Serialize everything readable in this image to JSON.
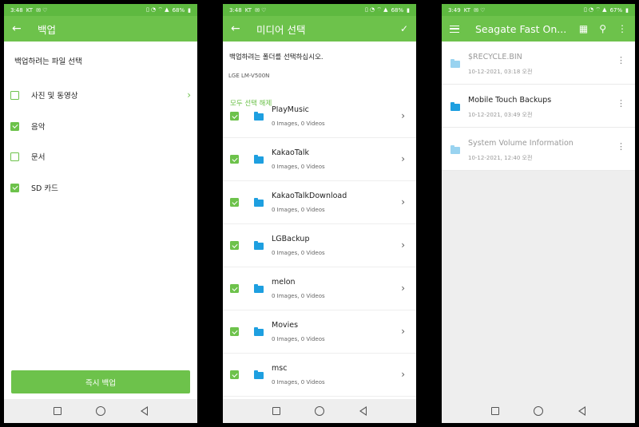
{
  "panel1": {
    "status": {
      "time": "3:48",
      "carrier": "KT",
      "battery": "68%"
    },
    "appbar": {
      "title": "백업"
    },
    "heading": "백업하려는 파일 선택",
    "options": [
      {
        "label": "사진 및 동영상",
        "checked": false,
        "has_chevron": true
      },
      {
        "label": "음악",
        "checked": true,
        "has_chevron": false
      },
      {
        "label": "문서",
        "checked": false,
        "has_chevron": false
      },
      {
        "label": "SD 카드",
        "checked": true,
        "has_chevron": false
      }
    ],
    "backup_button": "즉시 백업"
  },
  "panel2": {
    "status": {
      "time": "3:48",
      "carrier": "KT",
      "battery": "68%"
    },
    "appbar": {
      "title": "미디어 선택"
    },
    "instruction": "백업하려는 폴더를 선택하십시오.",
    "device": "LGE LM-V500N",
    "select_all": "모두 선택 해제",
    "folders": [
      {
        "name": "PlayMusic",
        "sub": "0 Images, 0 Videos",
        "checked": true
      },
      {
        "name": "KakaoTalk",
        "sub": "0 Images, 0 Videos",
        "checked": true
      },
      {
        "name": "KakaoTalkDownload",
        "sub": "0 Images, 0 Videos",
        "checked": true
      },
      {
        "name": "LGBackup",
        "sub": "0 Images, 0 Videos",
        "checked": true
      },
      {
        "name": "melon",
        "sub": "0 Images, 0 Videos",
        "checked": true
      },
      {
        "name": "Movies",
        "sub": "0 Images, 0 Videos",
        "checked": true
      },
      {
        "name": "msc",
        "sub": "0 Images, 0 Videos",
        "checked": true
      }
    ]
  },
  "panel3": {
    "status": {
      "time": "3:49",
      "carrier": "KT",
      "battery": "67%"
    },
    "appbar": {
      "title": "Seagate Fast On..."
    },
    "items": [
      {
        "name": "$RECYCLE.BIN",
        "date": "10-12-2021, 03:18 오전",
        "dim": true
      },
      {
        "name": "Mobile Touch Backups",
        "date": "10-12-2021, 03:49 오전",
        "dim": false
      },
      {
        "name": "System Volume Information",
        "date": "10-12-2021, 12:40 오전",
        "dim": true
      }
    ]
  },
  "colors": {
    "accent": "#6dc24b",
    "statusbar": "#5eb940",
    "folder": "#1e9fe0"
  },
  "icons": {
    "back": "arrow-left-icon",
    "confirm": "check-icon",
    "menu": "hamburger-icon",
    "grid": "grid-icon",
    "search": "search-icon",
    "more": "more-vert-icon"
  }
}
